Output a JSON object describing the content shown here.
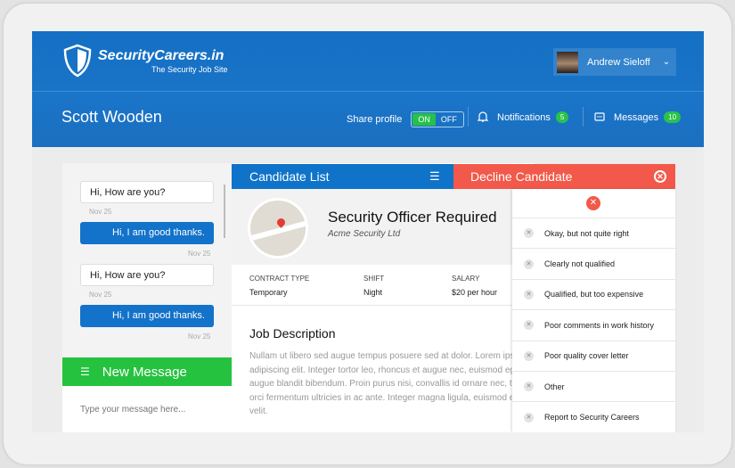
{
  "header": {
    "logo_title": "SecurityCareers.in",
    "logo_tagline": "The Security Job Site",
    "user_name": "Andrew Sieloff",
    "profile_name": "Scott Wooden",
    "share_profile_label": "Share profile",
    "toggle_on": "ON",
    "toggle_off": "OFF",
    "notifications_label": "Notifications",
    "notifications_count": "5",
    "messages_label": "Messages",
    "messages_count": "10"
  },
  "chat": {
    "messages": [
      {
        "text": "Hi, How are you?",
        "date": "Nov 25"
      },
      {
        "text": "Hi, I am good thanks.",
        "date": "Nov 25"
      },
      {
        "text": "Hi, How are you?",
        "date": "Nov 25"
      },
      {
        "text": "Hi, I am good thanks.",
        "date": "Nov 25"
      }
    ],
    "new_message_label": "New Message",
    "input_placeholder": "Type your message here..."
  },
  "main": {
    "candidate_list_label": "Candidate List",
    "job_title": "Security Officer Required",
    "company": "Acme Security Ltd",
    "meta": [
      {
        "label": "Contract Type",
        "value": "Temporary"
      },
      {
        "label": "Shift",
        "value": "Night"
      },
      {
        "label": "Salary",
        "value": "$20 per hour"
      }
    ],
    "description_title": "Job Description",
    "description_lines": [
      "Nullam ut libero sed augue tempus posuere sed at dolor. Lorem ipsu",
      "adipiscing elit. Integer tortor leo, rhoncus et augue nec, euismod eg",
      "augue blandit bibendum. Proin purus nisi, convallis id ornare nec, tr",
      "orci fermentum ultricies in ac ante. Integer magna ligula, euismod el",
      "velit."
    ]
  },
  "decline": {
    "title": "Decline Candidate",
    "reasons": [
      "Okay, but not quite right",
      "Clearly not qualified",
      "Qualified, but too expensive",
      "Poor comments in work history",
      "Poor quality cover letter",
      "Other",
      "Report to Security Careers"
    ]
  },
  "colors": {
    "brand_blue": "#1372c9",
    "decline_red": "#f2594a",
    "green": "#25c23f"
  }
}
